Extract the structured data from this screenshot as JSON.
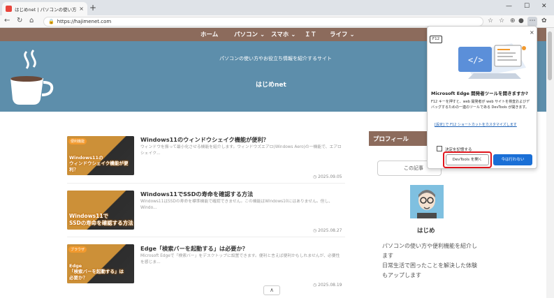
{
  "browser": {
    "tab_title": "はじめnet | パソコンの使い方やお役立",
    "tab_close": "×",
    "new_tab": "+",
    "url": "https://hajimenet.com",
    "window_controls": [
      "—",
      "☐",
      "✕"
    ]
  },
  "site": {
    "nav": [
      "ホーム",
      "パソコン ⌄",
      "スマホ ⌄",
      "ＩＴ",
      "ライフ ⌄"
    ],
    "tagline": "パソコンの使い方やお役立ち情報を紹介するサイト",
    "name": "はじめnet"
  },
  "posts": [
    {
      "thumb_tag": "便利機能",
      "thumb_text": "Windows11の\nウィンドウシェイク機能が便利？",
      "title": "Windows11のウィンドウシェイク機能が便利？",
      "excerpt": "ウィンドウを振って最小化させる機能を紹介します。ウィンドウズエアロ(Windows Aero)の一機能で、エアロシェイク...",
      "date": "◷ 2025.09.05"
    },
    {
      "thumb_tag": "",
      "thumb_text": "Windows11で\nSSDの寿命を確認する方法",
      "title": "Windows11でSSDの寿命を確認する方法",
      "excerpt": "Windows11はSSDの寿命を標準機能で確認できません。この機能はWindows10にはありません。但し、Windo...",
      "date": "◷ 2025.08.27"
    },
    {
      "thumb_tag": "ブラウザ",
      "thumb_text": "Edge\n「検索バーを起動する」は\n必要か？",
      "title": "Edge「検索バーを起動する」は必要か？",
      "excerpt": "Microsoft Edgeで「検索バー」をデスクトップに設置できます。便利と言えば便利かもしれませんが、必要性を感じま...",
      "date": "◷ 2025.08.19"
    }
  ],
  "sidebar": {
    "heading": "プロフィール",
    "bubble": "この記事",
    "name": "はじめ",
    "text": "パソコンの使い方や便利機能を紹介します\n日常生活で困ったことを解決した体験もアップします"
  },
  "popup": {
    "key": "F12",
    "title": "Microsoft Edge 開発者ツールを開きますか?",
    "desc": "F12 キーを押すと、web 開発者が web サイトを検査およびデバッグするための一連のツールである DevTools が開きます。",
    "link": "[設定] で F12 ショートカットをカスタマイズします",
    "remember": "決定を記憶する",
    "open_btn": "DevTools を開く",
    "no_btn": "今は行わない",
    "close": "×"
  },
  "scroll_up": "∧",
  "colors": {
    "nav_bg": "#8c6b5c",
    "banner_bg": "#5d8eab",
    "accent_blue": "#1a6fd6",
    "highlight_red": "#e0151c"
  }
}
